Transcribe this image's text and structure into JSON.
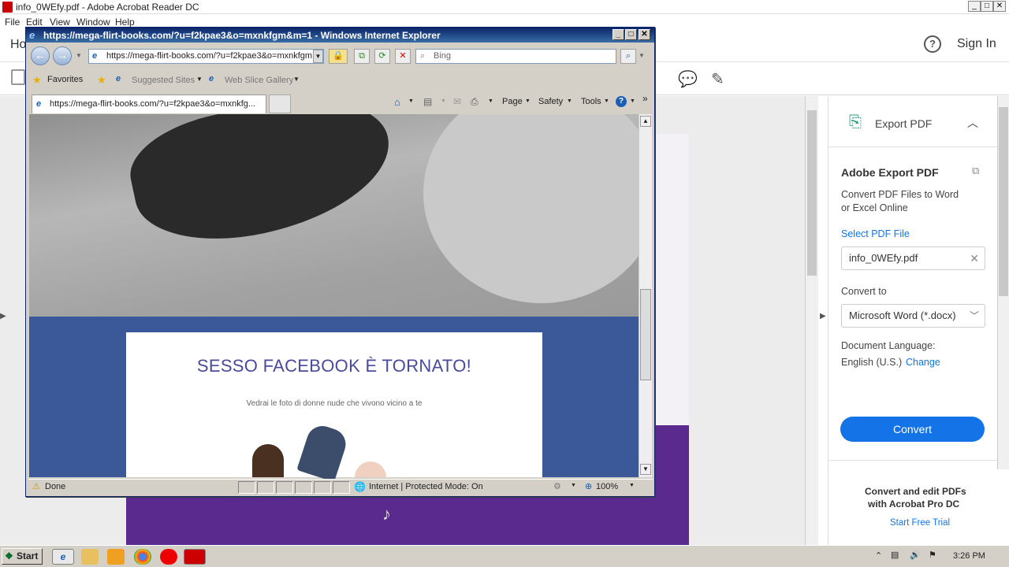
{
  "acrobat": {
    "title": "info_0WEfy.pdf - Adobe Acrobat Reader DC",
    "menu": [
      "File",
      "Edit",
      "View",
      "Window",
      "Help"
    ],
    "home_tab": "Ho",
    "sign_in": "Sign In",
    "export": {
      "header": "Export PDF",
      "heading": "Adobe Export PDF",
      "desc_line1": "Convert PDF Files to Word",
      "desc_line2": "or Excel Online",
      "select_file": "Select PDF File",
      "file_name": "info_0WEfy.pdf",
      "convert_to": "Convert to",
      "format": "Microsoft Word (*.docx)",
      "doc_lang_label": "Document Language:",
      "doc_lang": "English (U.S.)",
      "change": "Change",
      "convert_btn": "Convert",
      "promo_line1": "Convert and edit PDFs",
      "promo_line2": "with Acrobat Pro DC",
      "trial": "Start Free Trial"
    }
  },
  "ie": {
    "title": "https://mega-flirt-books.com/?u=f2kpae3&o=mxnkfgm&m=1 - Windows Internet Explorer",
    "address": "https://mega-flirt-books.com/?u=f2kpae3&o=mxnkfgm",
    "search_placeholder": "Bing",
    "favorites": "Favorites",
    "suggested": "Suggested Sites",
    "webslice": "Web Slice Gallery",
    "tab": "https://mega-flirt-books.com/?u=f2kpae3&o=mxnkfg...",
    "cmd": {
      "page": "Page",
      "safety": "Safety",
      "tools": "Tools"
    },
    "page": {
      "headline": "SESSO FACEBOOK È TORNATO!",
      "subtext": "Vedrai le foto di donne nude che vivono vicino a te"
    },
    "status": {
      "done": "Done",
      "zone": "Internet | Protected Mode: On",
      "zoom": "100%"
    }
  },
  "taskbar": {
    "start": "Start",
    "clock": "3:26 PM"
  },
  "colors": {
    "ie_bg": "#3b5998",
    "accent": "#1473e6",
    "headline": "#4a4a9a"
  }
}
